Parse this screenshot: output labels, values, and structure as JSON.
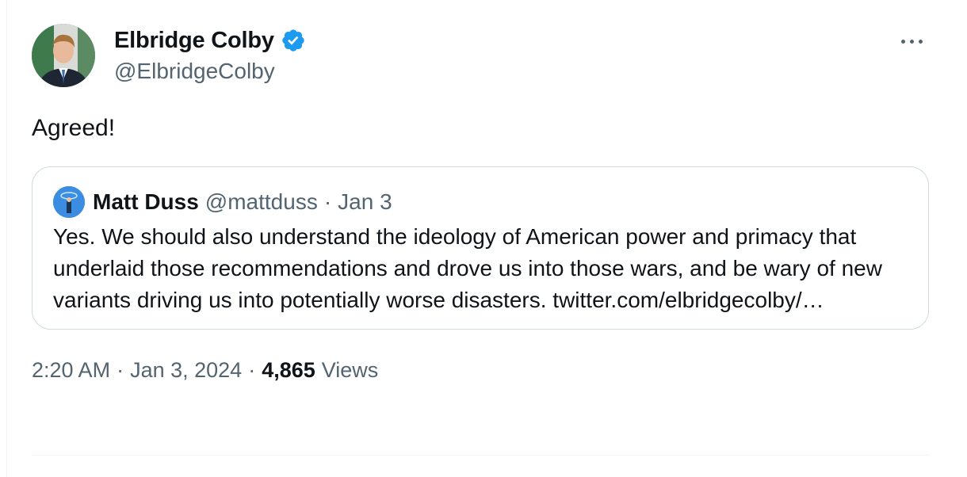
{
  "author": {
    "display_name": "Elbridge Colby",
    "handle": "@ElbridgeColby",
    "verified": true
  },
  "tweet": {
    "text": "Agreed!"
  },
  "quote": {
    "display_name": "Matt Duss",
    "handle": "@mattduss",
    "separator": "·",
    "date": "Jan 3",
    "text": "Yes. We should also understand the ideology of American power and primacy that underlaid those recommendations and drove us into those wars, and be wary of new variants driving us into potentially worse disasters. twitter.com/elbridgecolby/…"
  },
  "meta": {
    "time": "2:20 AM",
    "sep1": "·",
    "date": "Jan 3, 2024",
    "sep2": "·",
    "views_count": "4,865",
    "views_label": "Views"
  },
  "icons": {
    "verified": "verified-badge-icon",
    "more": "more-horizontal-icon"
  },
  "colors": {
    "text_primary": "#0f1419",
    "text_secondary": "#536471",
    "verified_blue": "#1d9bf0",
    "border": "#cfd9de"
  }
}
